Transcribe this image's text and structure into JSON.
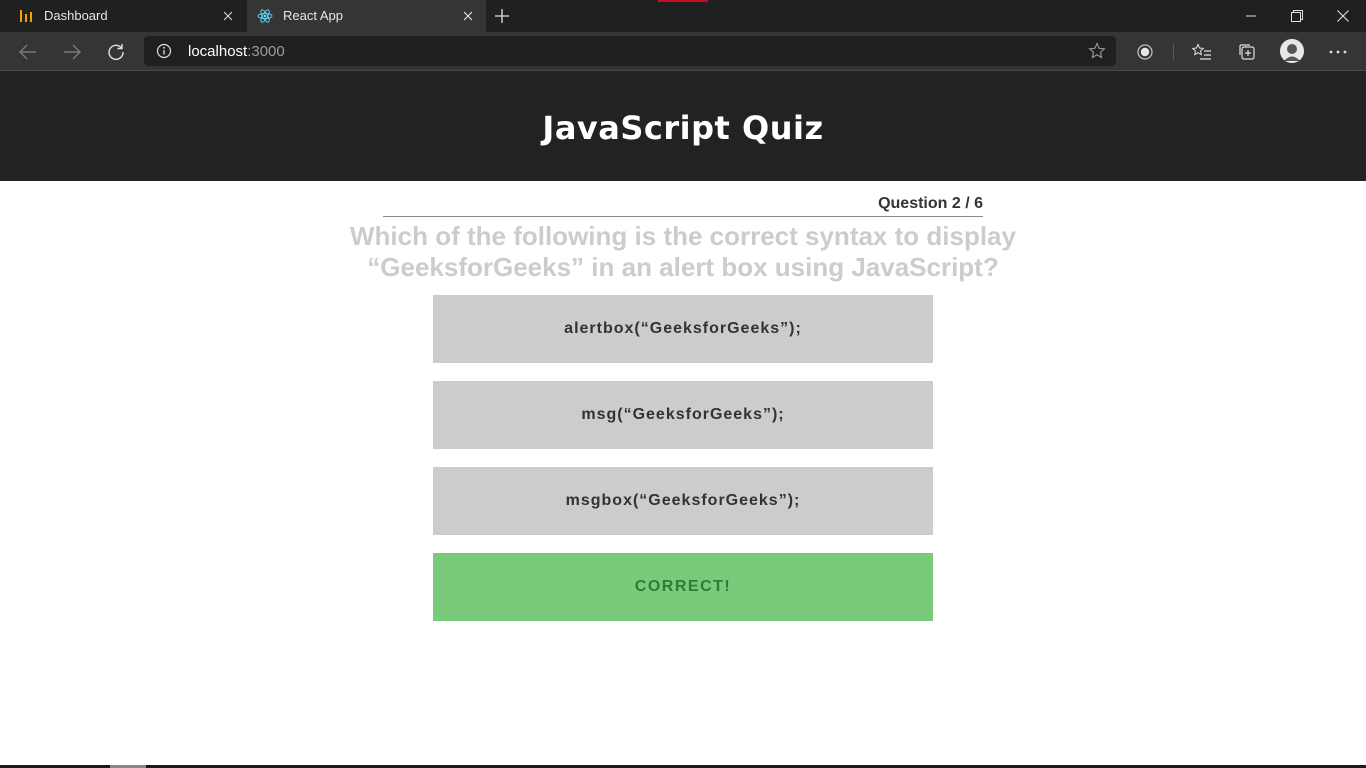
{
  "browser": {
    "tabs": [
      {
        "title": "Dashboard",
        "icon": "dashboard-bars-icon",
        "active": false
      },
      {
        "title": "React App",
        "icon": "react-logo-icon",
        "active": true
      }
    ],
    "address": {
      "host": "localhost",
      "port": ":3000"
    },
    "accent": "#c50f1f"
  },
  "quiz": {
    "title": "JavaScript Quiz",
    "counter": "Question 2 / 6",
    "question": "Which of the following is the correct syntax to display “GeeksforGeeks” in an alert box using JavaScript?",
    "options": [
      {
        "label": "alertbox(“GeeksforGeeks”);",
        "state": "neutral"
      },
      {
        "label": "msg(“GeeksforGeeks”);",
        "state": "neutral"
      },
      {
        "label": "msgbox(“GeeksforGeeks”);",
        "state": "neutral"
      },
      {
        "label": "CORRECT!",
        "state": "correct"
      }
    ]
  },
  "colors": {
    "header_bg": "#222222",
    "option_bg": "#cccccc",
    "correct_bg": "#79ca7b",
    "correct_text": "#2e7d32"
  }
}
